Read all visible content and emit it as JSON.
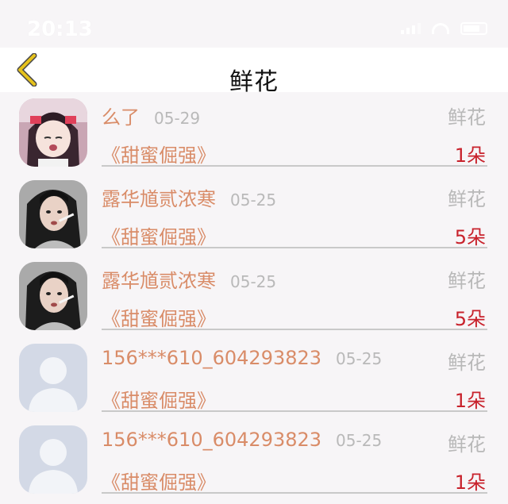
{
  "status_bar": {
    "time": "20:13"
  },
  "nav": {
    "title": "鲜花",
    "back_icon": "chevron-left-icon",
    "back_color": "#e6c21c"
  },
  "colors": {
    "name": "#d98c68",
    "quantity": "#c8222c",
    "muted": "#b8b8b8"
  },
  "records": [
    {
      "name": "么了",
      "date": "05-29",
      "gift": "鲜花",
      "book": "《甜蜜倔强》",
      "quantity": "1朵",
      "avatar": "anime-girl-avatar"
    },
    {
      "name": "露华馗贰浓寒",
      "date": "05-25",
      "gift": "鲜花",
      "book": "《甜蜜倔强》",
      "quantity": "5朵",
      "avatar": "photo-woman-avatar"
    },
    {
      "name": "露华馗贰浓寒",
      "date": "05-25",
      "gift": "鲜花",
      "book": "《甜蜜倔强》",
      "quantity": "5朵",
      "avatar": "photo-woman-avatar"
    },
    {
      "name": "156***610_604293823",
      "date": "05-25",
      "gift": "鲜花",
      "book": "《甜蜜倔强》",
      "quantity": "1朵",
      "avatar": "default-user-avatar"
    },
    {
      "name": "156***610_604293823",
      "date": "05-25",
      "gift": "鲜花",
      "book": "《甜蜜倔强》",
      "quantity": "1朵",
      "avatar": "default-user-avatar"
    }
  ]
}
